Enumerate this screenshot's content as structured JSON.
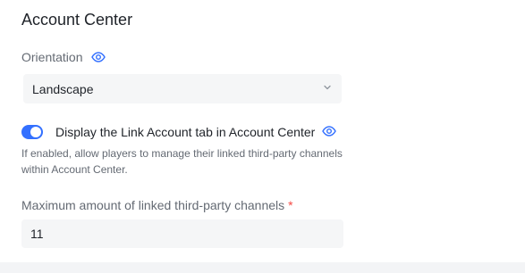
{
  "section": {
    "title": "Account Center"
  },
  "orientation": {
    "label": "Orientation",
    "icon": "eye-icon",
    "selected": "Landscape"
  },
  "link_account": {
    "enabled": true,
    "label": "Display the Link Account tab in Account Center",
    "icon": "eye-icon",
    "help": "If enabled, allow players to manage their linked third-party channels within Account Center."
  },
  "max_channels": {
    "label": "Maximum amount of linked third-party channels",
    "required_mark": "*",
    "value": "11"
  },
  "colors": {
    "accent": "#3370ff",
    "required": "#f54a45",
    "field_bg": "#f5f6f7",
    "muted_text": "#646a73"
  }
}
